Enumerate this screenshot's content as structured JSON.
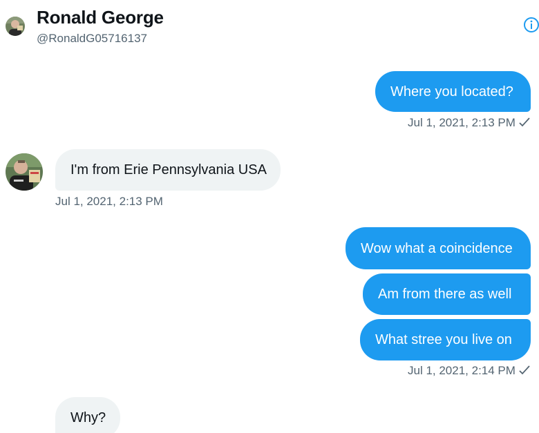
{
  "header": {
    "name": "Ronald George",
    "handle": "@RonaldG05716137",
    "info_icon": "info-icon"
  },
  "messages": [
    {
      "text": "Where you located?",
      "direction": "sent"
    },
    {
      "text": "Jul 1, 2021, 2:13 PM",
      "kind": "timestamp-sent"
    },
    {
      "text": "I'm from Erie Pennsylvania USA",
      "direction": "received"
    },
    {
      "text": "Jul 1, 2021, 2:13 PM",
      "kind": "timestamp-received"
    },
    {
      "text": "Wow what a coincidence",
      "direction": "sent"
    },
    {
      "text": "Am from there as well",
      "direction": "sent"
    },
    {
      "text": "What stree you live on",
      "direction": "sent"
    },
    {
      "text": "Jul 1, 2021, 2:14 PM",
      "kind": "timestamp-sent"
    },
    {
      "text": "Why?",
      "direction": "received"
    }
  ],
  "colors": {
    "sent_bubble": "#1d9bf0",
    "received_bubble": "#eff3f4",
    "secondary_text": "#536471"
  }
}
